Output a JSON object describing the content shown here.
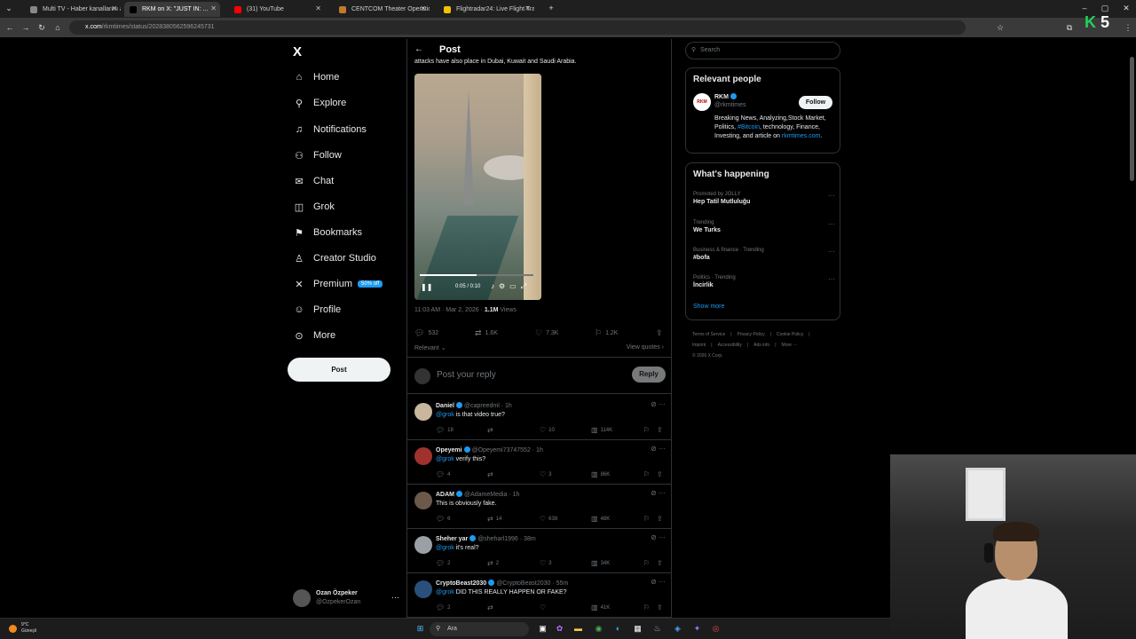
{
  "browser": {
    "tabs": [
      {
        "title": "Multi TV - Haber kanallarını aynı",
        "fav_color": "#888888",
        "active": false
      },
      {
        "title": "RKM on X: \"JUST IN: ...",
        "fav_color": "#000000",
        "active": true
      },
      {
        "title": "(31) YouTube",
        "fav_color": "#ff0000",
        "active": false
      },
      {
        "title": "CENTCOM Theater Operations",
        "fav_color": "#c27b2b",
        "active": false
      },
      {
        "title": "Flightradar24: Live Flight Track",
        "fav_color": "#f2c200",
        "active": false
      }
    ],
    "url_host": "x.com",
    "url_path": "/rkmtimes/status/2028380562596245731"
  },
  "nav": {
    "logo": "X",
    "items": [
      {
        "label": "Home",
        "icon": "home-icon",
        "glyph": "⌂"
      },
      {
        "label": "Explore",
        "icon": "search-icon",
        "glyph": "⚲"
      },
      {
        "label": "Notifications",
        "icon": "bell-icon",
        "glyph": "♫"
      },
      {
        "label": "Follow",
        "icon": "follow-icon",
        "glyph": "⚇"
      },
      {
        "label": "Chat",
        "icon": "mail-icon",
        "glyph": "✉"
      },
      {
        "label": "Grok",
        "icon": "grok-icon",
        "glyph": "◫"
      },
      {
        "label": "Bookmarks",
        "icon": "bookmark-icon",
        "glyph": "⚑"
      },
      {
        "label": "Creator Studio",
        "icon": "creator-studio-icon",
        "glyph": "♙"
      },
      {
        "label": "Premium",
        "icon": "x-premium-icon",
        "glyph": "✕"
      },
      {
        "label": "Profile",
        "icon": "profile-icon",
        "glyph": "☺"
      },
      {
        "label": "More",
        "icon": "more-icon",
        "glyph": "⊙"
      }
    ],
    "premium_badge": "50% off",
    "post_button": "Post",
    "account": {
      "name": "Ozan Özpeker",
      "handle": "@OzpekerOzan"
    }
  },
  "post": {
    "header_title": "Post",
    "snippet": "attacks have also place in Dubai, Kuwait and Saudi Arabia.",
    "video_time": "0:05 / 0:10",
    "video_progress": 0.5,
    "timestamp": "11:03 AM · Mar 2, 2026 · ",
    "views_count": "1.1M",
    "views_label": " Views",
    "stats": {
      "replies": "532",
      "reposts": "1.6K",
      "likes": "7.3K",
      "bookmarks": "1.2K"
    },
    "sort_label": "Relevant ⌄",
    "view_quotes": "View quotes ›",
    "reply_placeholder": "Post your reply",
    "reply_button": "Reply"
  },
  "replies": [
    {
      "name": "Daniel",
      "handle": "@capreedml · 1h",
      "mention": "@grok",
      "text": " is that video true?",
      "replies": "18",
      "reposts": "",
      "likes": "10",
      "views": "114K",
      "avatar_color": "#c8b79e"
    },
    {
      "name": "Opeyemi",
      "handle": "@Opeyemi73747552 · 1h",
      "mention": "@grok",
      "text": " verify this?",
      "replies": "4",
      "reposts": "",
      "likes": "3",
      "views": "86K",
      "avatar_color": "#a0322e"
    },
    {
      "name": "ADAM",
      "handle": "@AdameMedia · 1h",
      "mention": "",
      "text": "This is obviously fake.",
      "replies": "6",
      "reposts": "14",
      "likes": "638",
      "views": "48K",
      "avatar_color": "#6b5a4a"
    },
    {
      "name": "Sheher yar",
      "handle": "@sheharl1996 · 38m",
      "mention": "@grok",
      "text": " it's real?",
      "replies": "2",
      "reposts": "2",
      "likes": "3",
      "views": "34K",
      "avatar_color": "#9aa0a6"
    },
    {
      "name": "CryptoBeast2030",
      "handle": "@CryptoBeast2030 · 55m",
      "mention": "@grok",
      "text": " DID THIS REALLY HAPPEN OR FAKE?",
      "replies": "2",
      "reposts": "",
      "likes": "",
      "views": "41K",
      "avatar_color": "#2a4f7a"
    }
  ],
  "sidebar": {
    "search_placeholder": "Search",
    "relevant_title": "Relevant people",
    "person": {
      "name": "RKM",
      "handle": "@rkmtimes",
      "avatar_text": "RKM",
      "follow_label": "Follow",
      "bio_start": "Breaking News, Analyzing,Stock Market, Politics, ",
      "bio_tag": "#Bitcoin",
      "bio_mid": ", technology, Finance, Investing, and article on ",
      "bio_link": "rkmtimes.com",
      "bio_end": "."
    },
    "happening_title": "What's happening",
    "trends": [
      {
        "category": "Promoted by JOLLY",
        "title": "Hep Tatil Mutluluğu"
      },
      {
        "category": "Trending",
        "title": "We Turks"
      },
      {
        "category": "Business & finance · Trending",
        "title": "#bofa"
      },
      {
        "category": "Politics · Trending",
        "title": "İncirlik"
      }
    ],
    "show_more": "Show more",
    "footer": [
      "Terms of Service",
      "|",
      "Privacy Policy",
      "|",
      "Cookie Policy",
      "|",
      "Imprint",
      "|",
      "Accessibility",
      "|",
      "Ads info",
      "|",
      "More ···",
      "© 2026 X Corp."
    ]
  },
  "taskbar": {
    "temp": "9°C",
    "condition": "Güneşli",
    "search_label": "Ara"
  },
  "overlay_number": "5"
}
